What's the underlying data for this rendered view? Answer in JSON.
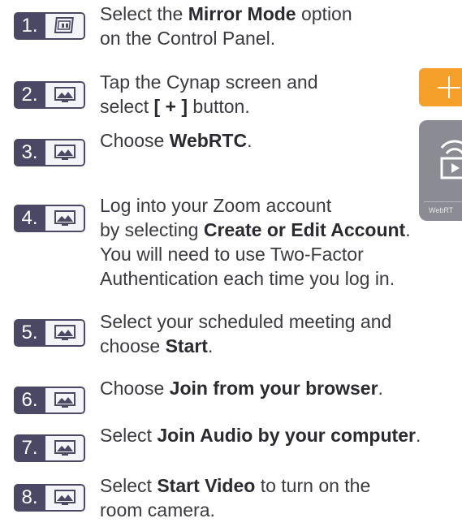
{
  "steps": [
    {
      "number": "1.",
      "icon": "control-panel-icon",
      "parts": [
        {
          "t": "Select the ",
          "b": false
        },
        {
          "t": "Mirror Mode",
          "b": true
        },
        {
          "t": " option",
          "b": false
        },
        {
          "br": true
        },
        {
          "t": "on the Control Panel.",
          "b": false
        }
      ]
    },
    {
      "number": "2.",
      "icon": "monitor-icon",
      "parts": [
        {
          "t": "Tap the Cynap screen and",
          "b": false
        },
        {
          "br": true
        },
        {
          "t": "select ",
          "b": false
        },
        {
          "t": "[ + ]",
          "b": true
        },
        {
          "t": " button.",
          "b": false
        }
      ]
    },
    {
      "number": "3.",
      "icon": "monitor-icon",
      "parts": [
        {
          "t": "Choose ",
          "b": false
        },
        {
          "t": "WebRTC",
          "b": true
        },
        {
          "t": ".",
          "b": false
        }
      ]
    },
    {
      "number": "4.",
      "icon": "monitor-icon",
      "parts": [
        {
          "t": "Log into your Zoom account",
          "b": false
        },
        {
          "br": true
        },
        {
          "t": "by selecting ",
          "b": false
        },
        {
          "t": "Create or Edit Account",
          "b": true
        },
        {
          "t": ".",
          "b": false
        },
        {
          "br": true
        },
        {
          "t": "You will need to use Two-Factor",
          "b": false
        },
        {
          "br": true
        },
        {
          "t": "Authentication each time you log in.",
          "b": false
        }
      ]
    },
    {
      "number": "5.",
      "icon": "monitor-icon",
      "parts": [
        {
          "t": "Select your scheduled meeting and",
          "b": false
        },
        {
          "br": true
        },
        {
          "t": "choose ",
          "b": false
        },
        {
          "t": "Start",
          "b": true
        },
        {
          "t": ".",
          "b": false
        }
      ]
    },
    {
      "number": "6.",
      "icon": "monitor-icon",
      "parts": [
        {
          "t": "Choose ",
          "b": false
        },
        {
          "t": "Join from your browser",
          "b": true
        },
        {
          "t": ".",
          "b": false
        }
      ]
    },
    {
      "number": "7.",
      "icon": "monitor-icon",
      "parts": [
        {
          "t": "Select ",
          "b": false
        },
        {
          "t": "Join Audio by your computer",
          "b": true
        },
        {
          "t": ".",
          "b": false
        }
      ]
    },
    {
      "number": "8.",
      "icon": "monitor-icon",
      "parts": [
        {
          "t": "Select ",
          "b": false
        },
        {
          "t": "Start Video",
          "b": true
        },
        {
          "t": " to turn on the",
          "b": false
        },
        {
          "br": true
        },
        {
          "t": "room camera.",
          "b": false
        }
      ]
    }
  ],
  "side_panel": {
    "plus_icon": "plus-icon",
    "webrtc_icon": "cast-play-icon",
    "webrtc_label": "WebRT"
  },
  "colors": {
    "badge": "#4b4866",
    "text": "#3a3a40",
    "plus_tile": "#f6a02c",
    "webrtc_tile": "#8b8c93"
  }
}
